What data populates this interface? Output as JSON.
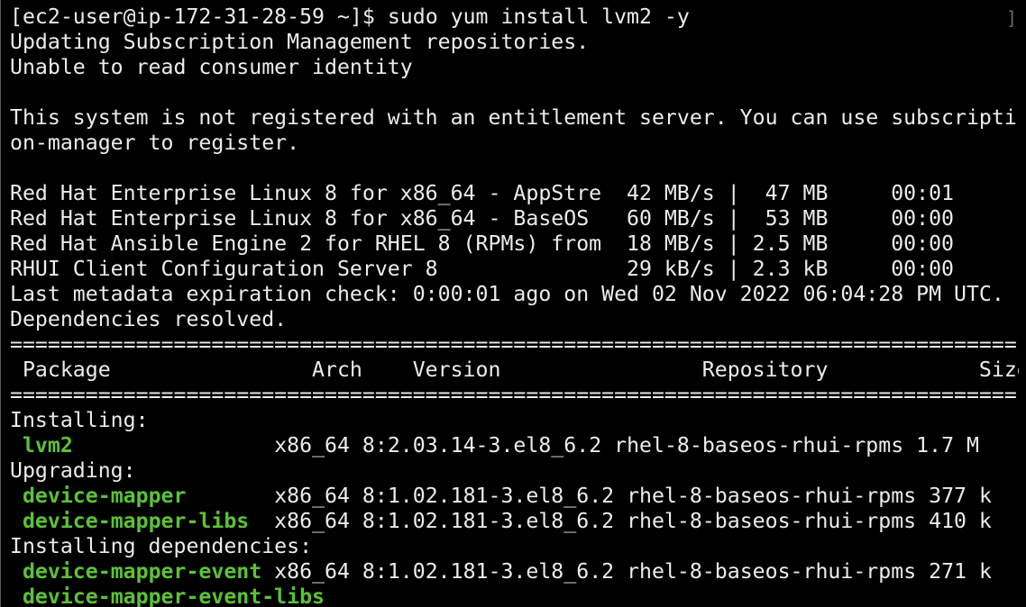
{
  "terminal": {
    "prompt": "[ec2-user@ip-172-31-28-59 ~]$ ",
    "command": "sudo yum install lvm2 -y",
    "closing_bracket": "]",
    "lines": {
      "l01": "Updating Subscription Management repositories.",
      "l02": "Unable to read consumer identity",
      "l03": "",
      "l04": "This system is not registered with an entitlement server. You can use subscripti",
      "l05": "on-manager to register.",
      "l06": "",
      "l07": "Red Hat Enterprise Linux 8 for x86_64 - AppStre  42 MB/s |  47 MB     00:01",
      "l08": "Red Hat Enterprise Linux 8 for x86_64 - BaseOS   60 MB/s |  53 MB     00:00",
      "l09": "Red Hat Ansible Engine 2 for RHEL 8 (RPMs) from  18 MB/s | 2.5 MB     00:00",
      "l10": "RHUI Client Configuration Server 8               29 kB/s | 2.3 kB     00:00",
      "l11": "Last metadata expiration check: 0:00:01 ago on Wed 02 Nov 2022 06:04:28 PM UTC.",
      "l12": "Dependencies resolved.",
      "l13": "================================================================================",
      "l14": " Package                Arch    Version                Repository            Size",
      "l15": "================================================================================",
      "l16": "Installing:",
      "l19": "Upgrading:",
      "l24": "Installing dependencies:"
    },
    "packages": [
      {
        "name": "lvm2",
        "rest": "x86_64 8:2.03.14-3.el8_6.2 rhel-8-baseos-rhui-rpms 1.7 M"
      },
      {
        "name": "device-mapper",
        "rest": "x86_64 8:1.02.181-3.el8_6.2 rhel-8-baseos-rhui-rpms 377 k"
      },
      {
        "name": "device-mapper-libs",
        "rest": "x86_64 8:1.02.181-3.el8_6.2 rhel-8-baseos-rhui-rpms 410 k"
      },
      {
        "name": "device-mapper-event",
        "rest": "x86_64 8:1.02.181-3.el8_6.2 rhel-8-baseos-rhui-rpms 271 k"
      },
      {
        "name": "device-mapper-event-libs",
        "rest": ""
      }
    ],
    "colors": {
      "background": "#000000",
      "text": "#ececec",
      "package_name": "#5bc236"
    }
  }
}
